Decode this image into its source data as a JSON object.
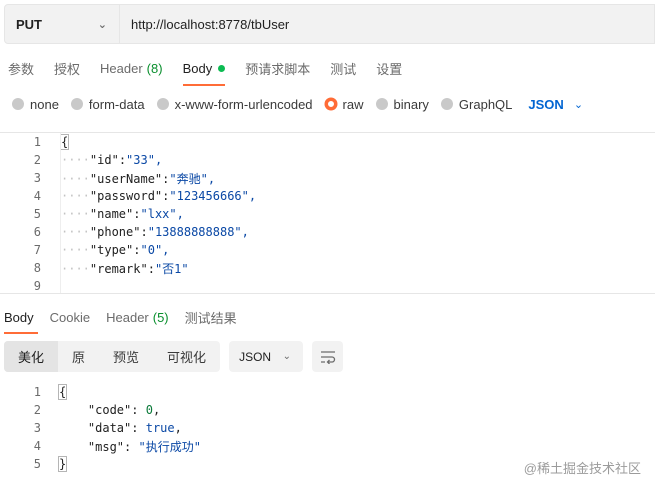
{
  "request": {
    "method": "PUT",
    "url": "http://localhost:8778/tbUser"
  },
  "request_tabs": [
    {
      "label": "参数"
    },
    {
      "label": "授权"
    },
    {
      "label": "Header",
      "count": "(8)"
    },
    {
      "label": "Body"
    },
    {
      "label": "预请求脚本"
    },
    {
      "label": "测试"
    },
    {
      "label": "设置"
    }
  ],
  "body_types": {
    "none": "none",
    "form_data": "form-data",
    "urlencoded": "x-www-form-urlencoded",
    "raw": "raw",
    "binary": "binary",
    "graphql": "GraphQL",
    "format": "JSON"
  },
  "request_body": {
    "line_numbers": [
      "1",
      "2",
      "3",
      "4",
      "5",
      "6",
      "7",
      "8",
      "9"
    ],
    "open": "{",
    "fields": [
      {
        "key": "\"id\"",
        "value": "\"33\","
      },
      {
        "key": "\"userName\"",
        "value": "\"奔驰\","
      },
      {
        "key": "\"password\"",
        "value": "\"123456666\","
      },
      {
        "key": "\"name\"",
        "value": "\"lxx\","
      },
      {
        "key": "\"phone\"",
        "value": "\"13888888888\","
      },
      {
        "key": "\"type\"",
        "value": "\"0\","
      },
      {
        "key": "\"remark\"",
        "value": "\"否1\""
      }
    ],
    "indent": "····"
  },
  "response_tabs": [
    {
      "label": "Body"
    },
    {
      "label": "Cookie"
    },
    {
      "label": "Header",
      "count": "(5)"
    },
    {
      "label": "测试结果"
    }
  ],
  "view_modes": {
    "pretty": "美化",
    "raw": "原",
    "preview": "预览",
    "visualize": "可视化",
    "format": "JSON"
  },
  "response_body": {
    "line_numbers": [
      "1",
      "2",
      "3",
      "4",
      "5"
    ],
    "open": "{",
    "close": "}",
    "code_key": "\"code\"",
    "code_val": "0",
    "data_key": "\"data\"",
    "data_val": "true",
    "msg_key": "\"msg\"",
    "msg_val": "\"执行成功\""
  },
  "watermark": "@稀土掘金技术社区",
  "colors": {
    "accent": "#ff6c37",
    "link": "#0265d2",
    "count_green": "#0a8f2e"
  }
}
